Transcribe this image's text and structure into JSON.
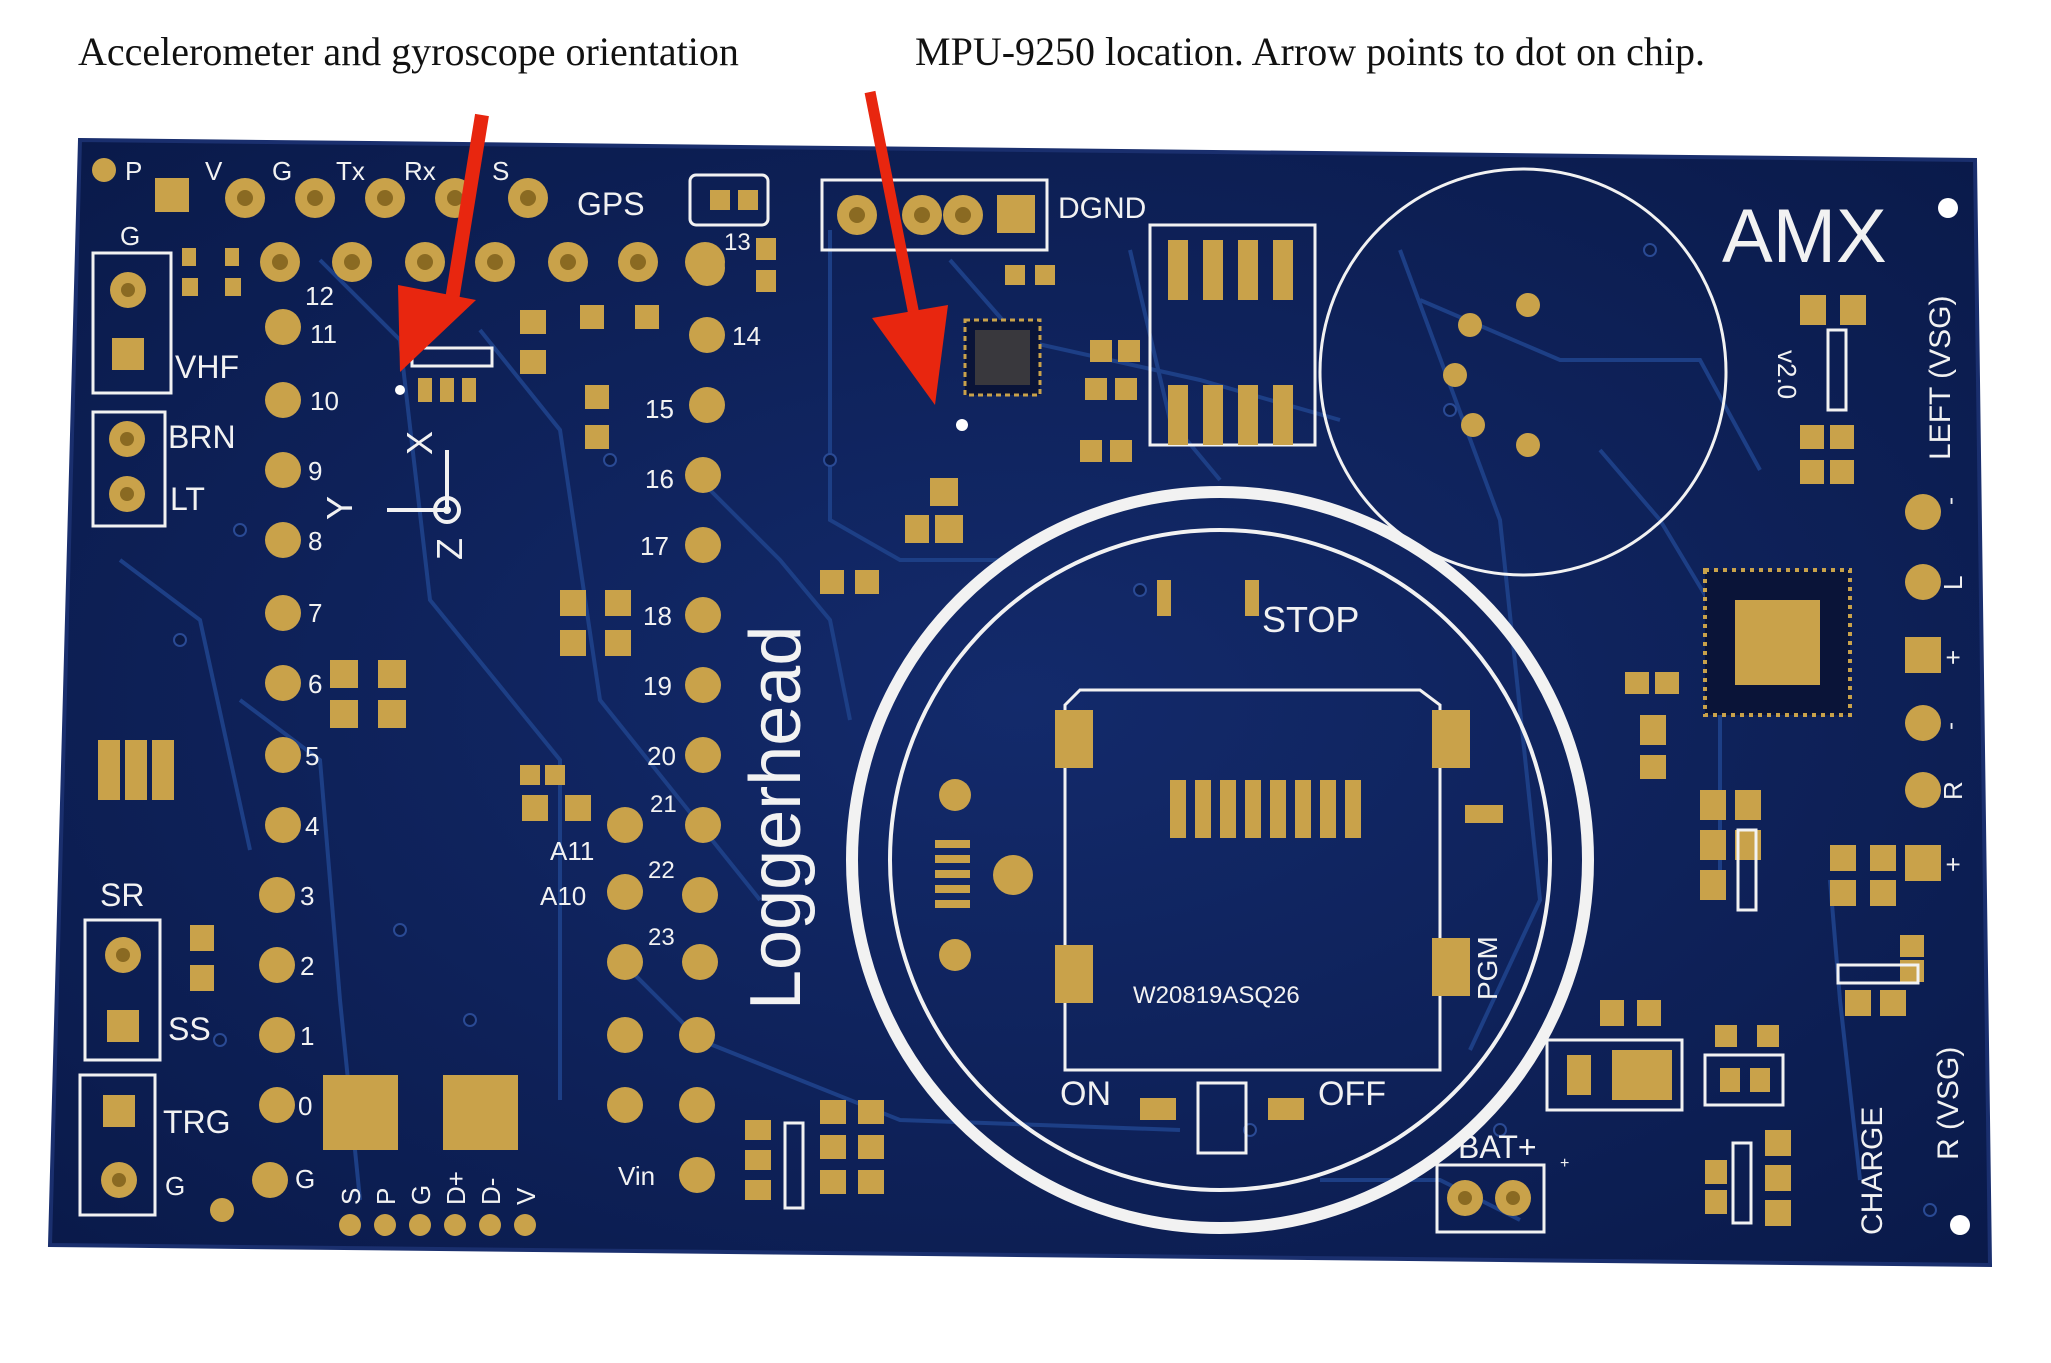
{
  "captions": {
    "left": "Accelerometer and gyroscope orientation",
    "right": "MPU-9250 location. Arrow points to dot on chip."
  },
  "board": {
    "brand": "AMX",
    "version": "v2.0",
    "name": "Loggerhead",
    "header_labels": [
      "P",
      "V",
      "G",
      "Tx",
      "Rx",
      "S"
    ],
    "gps": "GPS",
    "dgnd": "DGND",
    "side_labels": {
      "g_top": "G",
      "vhf": "VHF",
      "brn": "BRN",
      "lt": "LT",
      "sr": "SR",
      "ss": "SS",
      "trg": "TRG",
      "g_bottom": "G"
    },
    "left_pin_numbers": [
      "12",
      "11",
      "10",
      "9",
      "8",
      "7",
      "6",
      "5",
      "4",
      "3",
      "2",
      "1",
      "0",
      "G"
    ],
    "right_pin_numbers": [
      "13",
      "14",
      "15",
      "16",
      "17",
      "18",
      "19",
      "20",
      "21",
      "22",
      "23",
      "Vin"
    ],
    "analog": [
      "A11",
      "A10"
    ],
    "bottom_header": [
      "S",
      "P",
      "G",
      "D+",
      "D-",
      "V"
    ],
    "axes": {
      "x": "X",
      "y": "Y",
      "z": "Z"
    },
    "sd_card": {
      "stop": "STOP",
      "on": "ON",
      "off": "OFF",
      "pgm": "PGM",
      "code": "W20819ASQ26"
    },
    "right_edge": {
      "left_vsg": "LEFT (VSG)",
      "r_vsg": "R (VSG)",
      "charge": "CHARGE",
      "pin_marks": [
        "-",
        "L",
        "+",
        "-",
        "R",
        "+"
      ]
    },
    "battery": "BAT+",
    "battery_minus": "-",
    "battery_plus_small": "+"
  },
  "colors": {
    "board": "#0d1f57",
    "pad": "#c9a24a",
    "silkscreen": "#f2f2f2",
    "arrow": "#e8260f"
  }
}
